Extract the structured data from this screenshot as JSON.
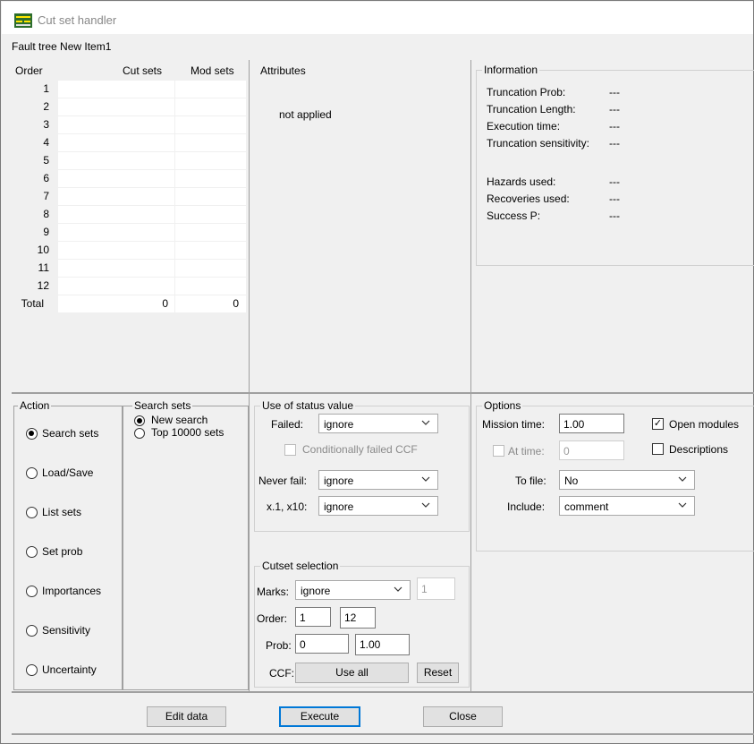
{
  "window": {
    "title": "Cut set handler"
  },
  "menubar": {
    "label": "Fault tree New Item1"
  },
  "grid": {
    "headers": {
      "order": "Order",
      "cut_sets": "Cut sets",
      "mod_sets": "Mod sets"
    },
    "rows": [
      "1",
      "2",
      "3",
      "4",
      "5",
      "6",
      "7",
      "8",
      "9",
      "10",
      "11",
      "12"
    ],
    "total_label": "Total",
    "total_cut": "0",
    "total_mod": "0"
  },
  "attributes": {
    "title": "Attributes",
    "status": "not applied"
  },
  "information": {
    "title": "Information",
    "rows": [
      {
        "label": "Truncation Prob:",
        "value": "---"
      },
      {
        "label": "Truncation Length:",
        "value": "---"
      },
      {
        "label": "Execution time:",
        "value": "---"
      },
      {
        "label": "Truncation sensitivity:",
        "value": "---"
      },
      {
        "label": "Hazards used:",
        "value": "---"
      },
      {
        "label": "Recoveries used:",
        "value": "---"
      },
      {
        "label": "Success P:",
        "value": "---"
      }
    ]
  },
  "action": {
    "title": "Action",
    "items": [
      "Search sets",
      "Load/Save",
      "List sets",
      "Set prob",
      "Importances",
      "Sensitivity",
      "Uncertainty"
    ],
    "selected": "Search sets"
  },
  "search": {
    "title": "Search sets",
    "options": [
      "New search",
      "Top 10000 sets"
    ],
    "selected": "New search"
  },
  "status_value": {
    "title": "Use of status value",
    "failed_label": "Failed:",
    "failed_value": "ignore",
    "ccf_label": "Conditionally failed CCF",
    "never_fail_label": "Never fail:",
    "never_fail_value": "ignore",
    "x_label": "x.1, x10:",
    "x_value": "ignore"
  },
  "options": {
    "title": "Options",
    "mission_label": "Mission time:",
    "mission_value": "1.00",
    "open_modules": "Open modules",
    "descriptions": "Descriptions",
    "at_time_label": "At time:",
    "at_time_value": "0",
    "to_file_label": "To file:",
    "to_file_value": "No",
    "include_label": "Include:",
    "include_value": "comment"
  },
  "cutset": {
    "title": "Cutset selection",
    "marks_label": "Marks:",
    "marks_value": "ignore",
    "marks_num": "1",
    "order_label": "Order:",
    "order_from": "1",
    "order_to": "12",
    "prob_label": "Prob:",
    "prob_from": "0",
    "prob_to": "1.00",
    "ccf_label": "CCF:",
    "use_all": "Use all",
    "reset": "Reset"
  },
  "buttons": {
    "edit": "Edit data",
    "execute": "Execute",
    "close": "Close"
  }
}
